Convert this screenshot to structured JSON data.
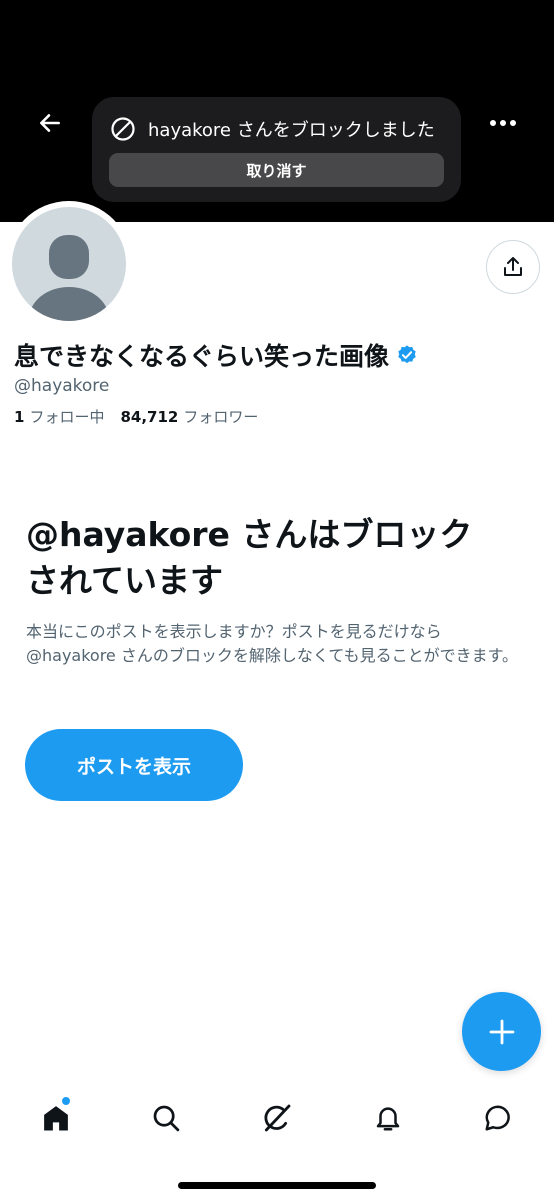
{
  "header": {
    "back_icon": "arrow-left-icon",
    "more_icon": "more-horizontal-icon"
  },
  "toast": {
    "icon": "block-icon",
    "message": "hayakore さんをブロックしました",
    "undo_label": "取り消す"
  },
  "profile": {
    "display_name": "息できなくなるぐらい笑った画像",
    "verified": true,
    "handle": "@hayakore",
    "following_count": "1",
    "following_label": "フォロー中",
    "followers_count": "84,712",
    "followers_label": "フォロワー"
  },
  "blocked": {
    "title_line1": "@hayakore さんはブロック",
    "title_line2": "されています",
    "description": "本当にこのポストを表示しますか？ポストを見るだけなら @hayakore さんのブロックを解除しなくても見ることができます。",
    "button_label": "ポストを表示"
  },
  "tabbar": {
    "items": [
      "home-icon",
      "search-icon",
      "grok-icon",
      "notifications-icon",
      "messages-icon"
    ],
    "active": "home-icon"
  },
  "colors": {
    "accent": "#1d9bf0",
    "banner": "#000000",
    "muted_text": "#536471"
  }
}
